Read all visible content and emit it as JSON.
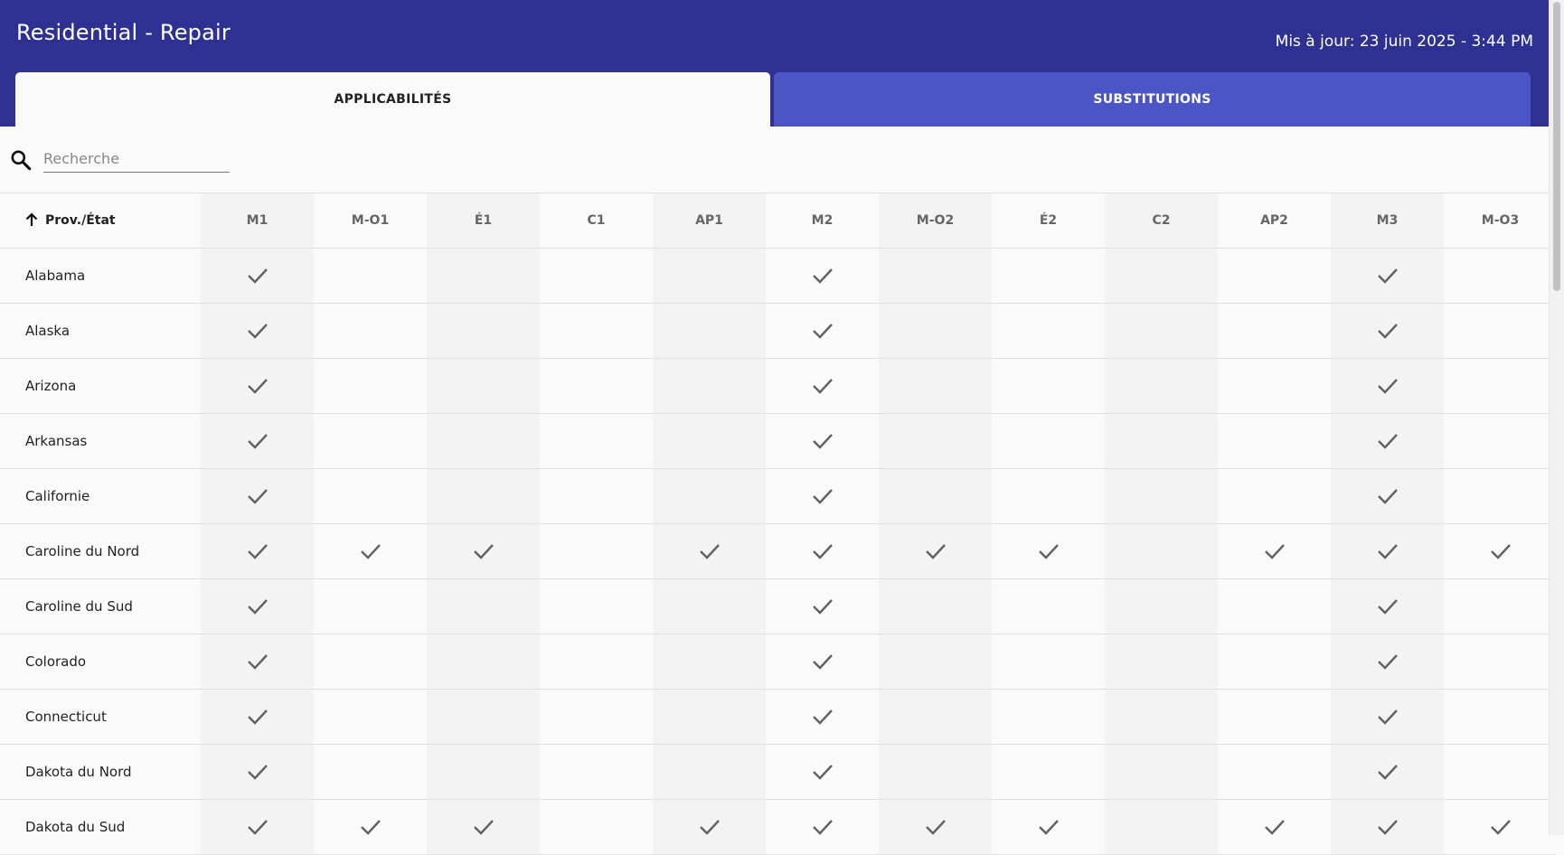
{
  "header": {
    "title": "Residential - Repair",
    "updated": "Mis à jour: 23 juin 2025 - 3:44 PM"
  },
  "tabs": [
    {
      "label": "APPLICABILITÉS",
      "active": true
    },
    {
      "label": "SUBSTITUTIONS",
      "active": false
    }
  ],
  "search": {
    "placeholder": "Recherche",
    "value": ""
  },
  "table": {
    "first_column_label": "Prov./État",
    "sort": "ascending",
    "columns": [
      "M1",
      "M-O1",
      "É1",
      "C1",
      "AP1",
      "M2",
      "M-O2",
      "É2",
      "C2",
      "AP2",
      "M3",
      "M-O3"
    ],
    "rows": [
      {
        "name": "Alabama",
        "checks": [
          1,
          0,
          0,
          0,
          0,
          1,
          0,
          0,
          0,
          0,
          1,
          0
        ]
      },
      {
        "name": "Alaska",
        "checks": [
          1,
          0,
          0,
          0,
          0,
          1,
          0,
          0,
          0,
          0,
          1,
          0
        ]
      },
      {
        "name": "Arizona",
        "checks": [
          1,
          0,
          0,
          0,
          0,
          1,
          0,
          0,
          0,
          0,
          1,
          0
        ]
      },
      {
        "name": "Arkansas",
        "checks": [
          1,
          0,
          0,
          0,
          0,
          1,
          0,
          0,
          0,
          0,
          1,
          0
        ]
      },
      {
        "name": "Californie",
        "checks": [
          1,
          0,
          0,
          0,
          0,
          1,
          0,
          0,
          0,
          0,
          1,
          0
        ]
      },
      {
        "name": "Caroline du Nord",
        "checks": [
          1,
          1,
          1,
          0,
          1,
          1,
          1,
          1,
          0,
          1,
          1,
          1
        ]
      },
      {
        "name": "Caroline du Sud",
        "checks": [
          1,
          0,
          0,
          0,
          0,
          1,
          0,
          0,
          0,
          0,
          1,
          0
        ]
      },
      {
        "name": "Colorado",
        "checks": [
          1,
          0,
          0,
          0,
          0,
          1,
          0,
          0,
          0,
          0,
          1,
          0
        ]
      },
      {
        "name": "Connecticut",
        "checks": [
          1,
          0,
          0,
          0,
          0,
          1,
          0,
          0,
          0,
          0,
          1,
          0
        ]
      },
      {
        "name": "Dakota du Nord",
        "checks": [
          1,
          0,
          0,
          0,
          0,
          1,
          0,
          0,
          0,
          0,
          1,
          0
        ]
      },
      {
        "name": "Dakota du Sud",
        "checks": [
          1,
          1,
          1,
          0,
          1,
          1,
          1,
          1,
          0,
          1,
          1,
          1
        ]
      }
    ]
  },
  "colors": {
    "header_bg": "#2e3192",
    "inactive_tab_bg": "#4b56c4",
    "alt_column_bg": "#f3f3f3",
    "check": "#616161"
  },
  "icons": {
    "search": "search-icon",
    "sort": "arrow-up-icon",
    "check": "check-icon"
  }
}
